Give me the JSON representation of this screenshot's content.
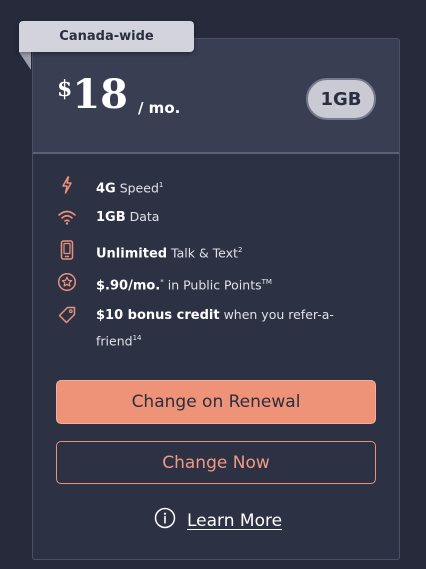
{
  "plan": {
    "region_tag": "Canada-wide",
    "currency_symbol": "$",
    "price": "18",
    "period": "/ mo.",
    "data_badge": "1GB"
  },
  "features": [
    {
      "icon": "lightning-bolt-icon",
      "bold": "4G",
      "text": " Speed",
      "sup": "1"
    },
    {
      "icon": "wifi-icon",
      "bold": "1GB",
      "text": " Data",
      "sup": ""
    },
    {
      "icon": "phone-icon",
      "bold": "Unlimited",
      "text": " Talk & Text",
      "sup": "2"
    },
    {
      "icon": "star-badge-icon",
      "bold": "$.90/mo.",
      "bold_sup": "*",
      "text": " in Public Points",
      "sup": "TM"
    },
    {
      "icon": "tag-icon",
      "bold": "$10 bonus credit",
      "text": " when you refer-a-",
      "text2": "friend",
      "sup": "14"
    }
  ],
  "actions": {
    "primary_label": "Change on Renewal",
    "secondary_label": "Change Now",
    "learn_more_label": "Learn More"
  },
  "colors": {
    "background": "#262a3b",
    "card": "#2d3144",
    "accent": "#ee9378",
    "icon": "#e9917a"
  }
}
